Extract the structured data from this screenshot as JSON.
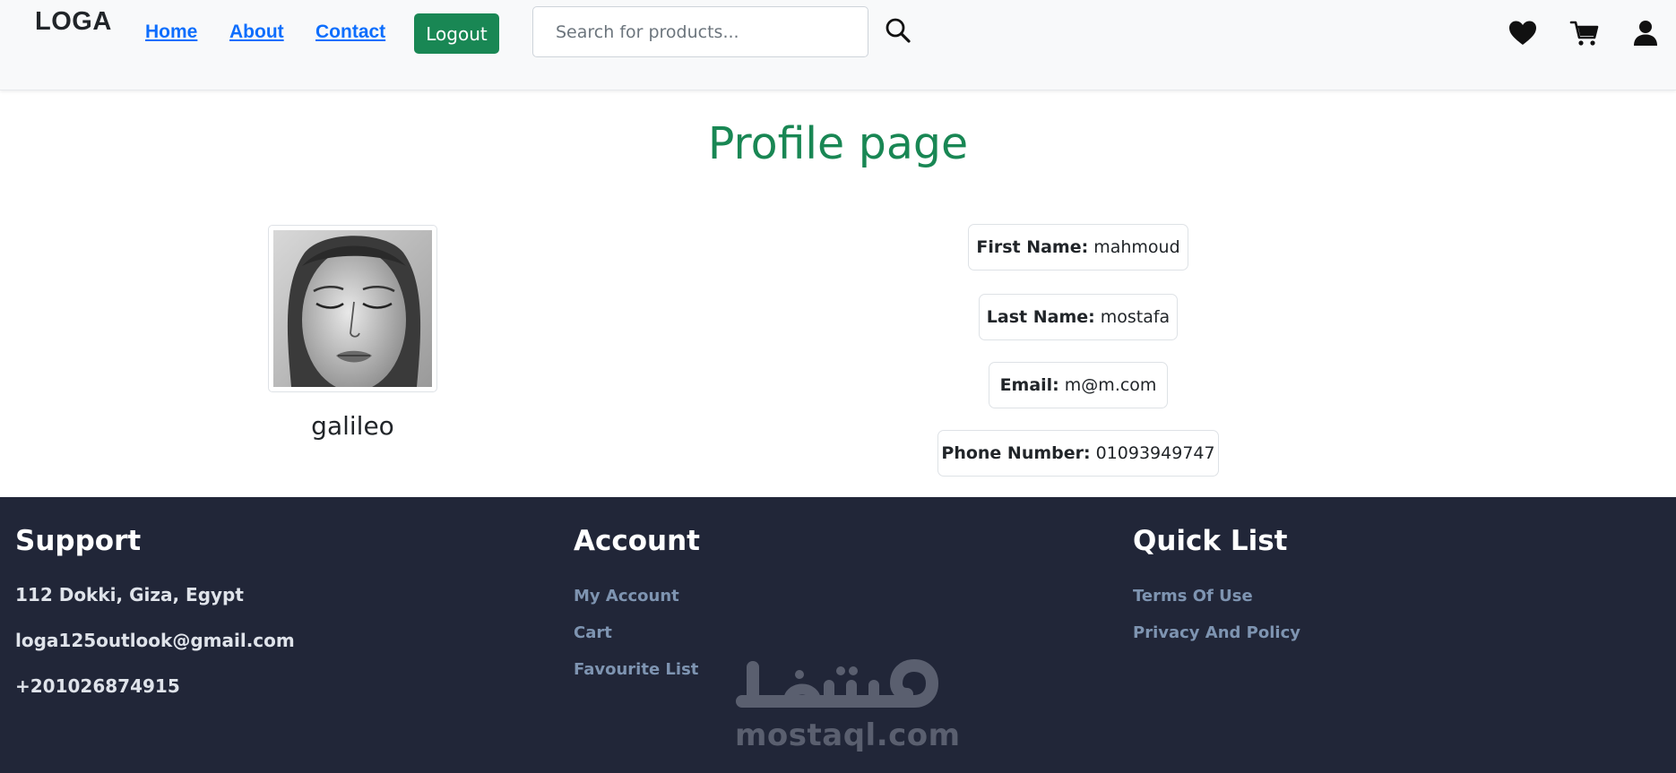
{
  "header": {
    "brand": "LOGA",
    "nav": [
      {
        "label": "Home"
      },
      {
        "label": "About"
      },
      {
        "label": "Contact"
      }
    ],
    "logout_label": "Logout",
    "search": {
      "placeholder": "Search for products...",
      "value": ""
    },
    "icons": [
      "search-icon",
      "heart-icon",
      "cart-icon",
      "user-icon"
    ]
  },
  "profile": {
    "title": "Profile page",
    "username": "galileo",
    "fields": [
      {
        "label": "First Name:",
        "value": "mahmoud"
      },
      {
        "label": "Last Name:",
        "value": "mostafa"
      },
      {
        "label": "Email:",
        "value": "m@m.com"
      },
      {
        "label": "Phone Number:",
        "value": "01093949747"
      }
    ]
  },
  "footer": {
    "support": {
      "title": "Support",
      "lines": [
        "112 Dokki, Giza, Egypt",
        "loga125outlook@gmail.com",
        "+201026874915"
      ]
    },
    "account": {
      "title": "Account",
      "links": [
        "My Account",
        "Cart",
        "Favourite List"
      ]
    },
    "quick_list": {
      "title": "Quick List",
      "links": [
        "Terms Of Use",
        "Privacy And Policy"
      ]
    },
    "watermark": {
      "arabic": "مستقل",
      "latin": "mostaql.com"
    }
  },
  "colors": {
    "accent_green": "#198754",
    "link_blue": "#0d6efd",
    "footer_bg": "#212638",
    "footer_link": "#7e94b1"
  }
}
